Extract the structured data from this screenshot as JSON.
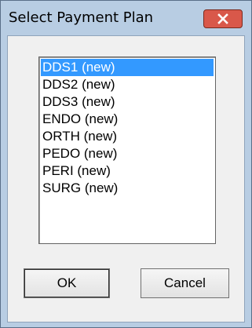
{
  "window": {
    "title": "Select Payment Plan",
    "close_icon": "close-icon"
  },
  "list": {
    "items": [
      {
        "label": "DDS1  (new)",
        "selected": true
      },
      {
        "label": "DDS2  (new)",
        "selected": false
      },
      {
        "label": "DDS3  (new)",
        "selected": false
      },
      {
        "label": "ENDO  (new)",
        "selected": false
      },
      {
        "label": "ORTH  (new)",
        "selected": false
      },
      {
        "label": "PEDO  (new)",
        "selected": false
      },
      {
        "label": "PERI  (new)",
        "selected": false
      },
      {
        "label": "SURG  (new)",
        "selected": false
      }
    ]
  },
  "buttons": {
    "ok_label": "OK",
    "cancel_label": "Cancel"
  },
  "colors": {
    "selection": "#3399ff",
    "title_bar": "#b8cde3",
    "close_button": "#d9584a"
  }
}
